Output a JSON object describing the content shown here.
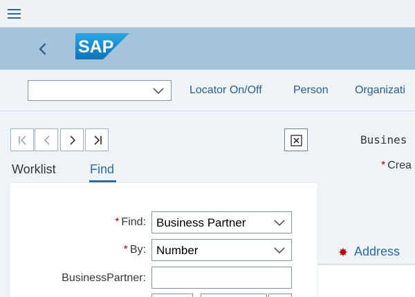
{
  "shell": {
    "menu_icon": "hamburger-menu-icon",
    "back_icon": "chevron-left-icon",
    "logo_text": "SAP"
  },
  "toolbar": {
    "select_value": "",
    "locator_label": "Locator On/Off",
    "person_label": "Person",
    "organization_label": "Organizati"
  },
  "navigation": {
    "first_icon": "first-page-icon",
    "prev_icon": "previous-page-icon",
    "next_icon": "next-page-icon",
    "last_icon": "last-page-icon",
    "close_icon": "close-panel-icon"
  },
  "tabs": [
    {
      "label": "Worklist",
      "selected": false
    },
    {
      "label": "Find",
      "selected": true
    }
  ],
  "find_form": {
    "find_label": "Find:",
    "find_value": "Business Partner",
    "by_label": "By:",
    "by_value": "Number",
    "bp_label": "BusinessPartner:",
    "bp_value": "",
    "required_marker": "*"
  },
  "detail": {
    "title_mono": "Busines",
    "create_label": "Crea",
    "address_tab": "Address",
    "address_status": "error"
  },
  "colors": {
    "accent": "#2b6aa6",
    "header_band": "#a7c3da",
    "required": "#bb0000",
    "sap_logo_blue": "#1b86c8"
  }
}
